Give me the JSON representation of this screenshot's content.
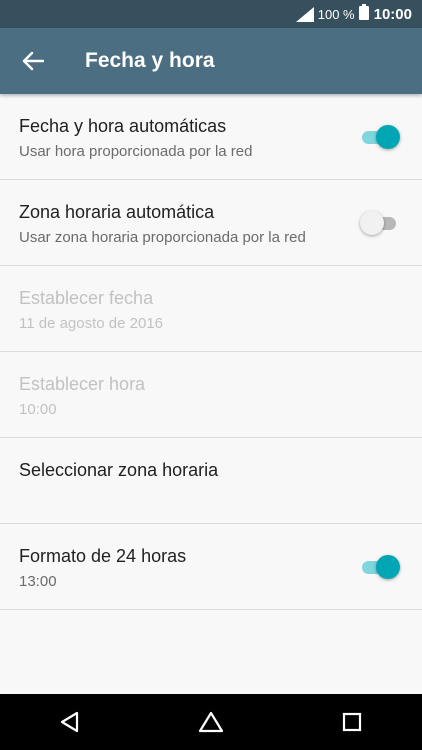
{
  "status_bar": {
    "battery_percent": "100 %",
    "time": "10:00",
    "icons": [
      "signal-icon",
      "battery-icon"
    ]
  },
  "app_bar": {
    "title": "Fecha y hora",
    "back_icon": "back-arrow-icon"
  },
  "settings": [
    {
      "title": "Fecha y hora automáticas",
      "subtitle": "Usar hora proporcionada por la red",
      "toggle": true,
      "enabled": true
    },
    {
      "title": "Zona horaria automática",
      "subtitle": "Usar zona horaria proporcionada por la red",
      "toggle": false,
      "enabled": true
    },
    {
      "title": "Establecer fecha",
      "subtitle": "11 de agosto de 2016",
      "enabled": false
    },
    {
      "title": "Establecer hora",
      "subtitle": "10:00",
      "enabled": false
    },
    {
      "title": "Seleccionar zona horaria",
      "subtitle": "",
      "enabled": true
    },
    {
      "title": "Formato de 24 horas",
      "subtitle": "13:00",
      "toggle": true,
      "enabled": true
    }
  ],
  "colors": {
    "status_bar": "#37505e",
    "app_bar": "#4b6e82",
    "accent": "#00a6b4",
    "accent_track": "#80d6dc",
    "background": "#f8f8f8"
  },
  "nav_bar": {
    "icons": [
      "back-triangle-icon",
      "home-icon",
      "recents-icon"
    ]
  }
}
